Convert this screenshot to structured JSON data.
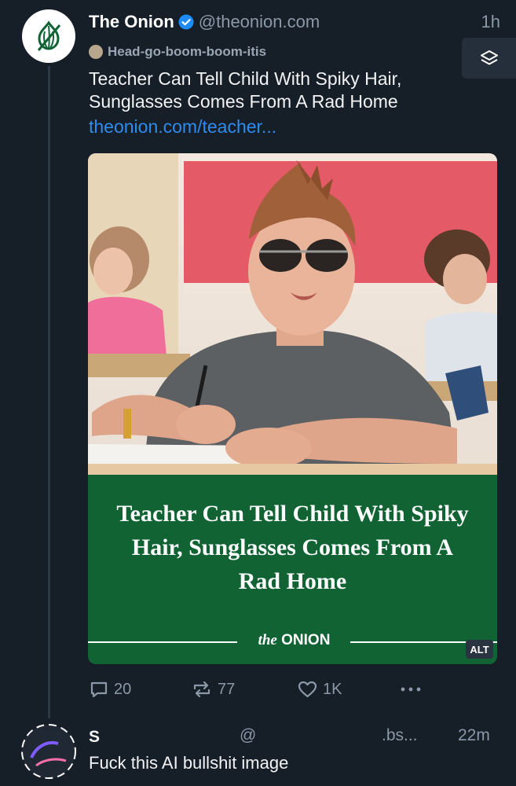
{
  "post": {
    "author": {
      "display_name": "The Onion",
      "handle": "@theonion.com",
      "verified": true,
      "avatar_icon": "onion-logo-icon"
    },
    "timestamp": "1h",
    "label": "Head-go-boom-boom-itis",
    "text": "Teacher Can Tell Child With Spiky Hair, Sunglasses Comes From A Rad Home",
    "link": "theonion.com/teacher...",
    "embed": {
      "photo_icon": "classroom-boy-sunglasses-photo",
      "headline": "Teacher Can Tell Child With Spiky Hair, Sunglasses Comes From A Rad Home",
      "logo_prefix": "the",
      "logo_name": "ONION",
      "alt_badge": "ALT"
    },
    "actions": {
      "replies": "20",
      "reposts": "77",
      "likes": "1K",
      "more_icon": "more-dots-icon"
    }
  },
  "reply": {
    "display_name_fragment": "S",
    "handle_fragment": "@",
    "handle_tail": ".bs...",
    "timestamp": "22m",
    "text": "Fuck this AI bullshit image"
  },
  "colors": {
    "background": "#161e27",
    "link": "#2d8cf0",
    "onion_green": "#116334",
    "muted": "#8b98a8",
    "verified_blue": "#1d8cf8"
  }
}
